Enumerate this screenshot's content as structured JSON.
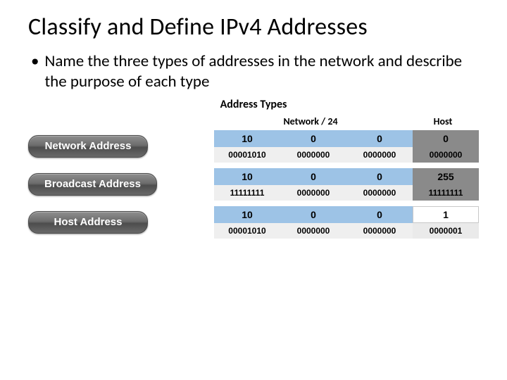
{
  "title": "Classify and Define IPv4 Addresses",
  "bullet": "Name the three types of addresses in the network and describe the purpose of each type",
  "subtitle": "Address Types",
  "headers": {
    "network": "Network / 24",
    "host": "Host"
  },
  "rows": [
    {
      "label": "Network Address",
      "dec": [
        "10",
        "0",
        "0",
        "0"
      ],
      "bin": [
        "00001010",
        "0000000",
        "0000000",
        "0000000"
      ],
      "host_style": "grey"
    },
    {
      "label": "Broadcast Address",
      "dec": [
        "10",
        "0",
        "0",
        "255"
      ],
      "bin": [
        "11111111",
        "0000000",
        "0000000",
        "11111111"
      ],
      "host_style": "grey"
    },
    {
      "label": "Host Address",
      "dec": [
        "10",
        "0",
        "0",
        "1"
      ],
      "bin": [
        "00001010",
        "0000000",
        "0000000",
        "0000001"
      ],
      "host_style": "white"
    }
  ]
}
